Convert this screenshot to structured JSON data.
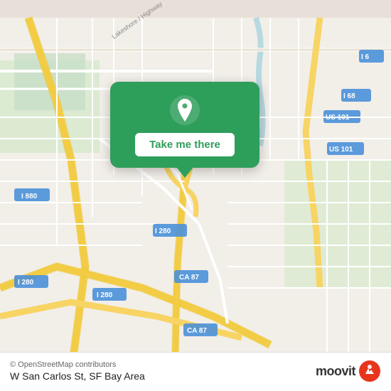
{
  "map": {
    "background_color": "#f2efe9",
    "alt": "Map of SF Bay Area showing W San Carlos St"
  },
  "popup": {
    "button_label": "Take me there",
    "pin_icon": "location-pin"
  },
  "bottom_bar": {
    "copyright": "© OpenStreetMap contributors",
    "location": "W San Carlos St, SF Bay Area"
  },
  "moovit": {
    "logo_text": "moovit"
  },
  "colors": {
    "green": "#2e9e5b",
    "road_major": "#f7d98b",
    "road_minor": "#ffffff",
    "highway_fill": "#f7d464",
    "green_area": "#c8dfc8",
    "water": "#aad3df"
  }
}
